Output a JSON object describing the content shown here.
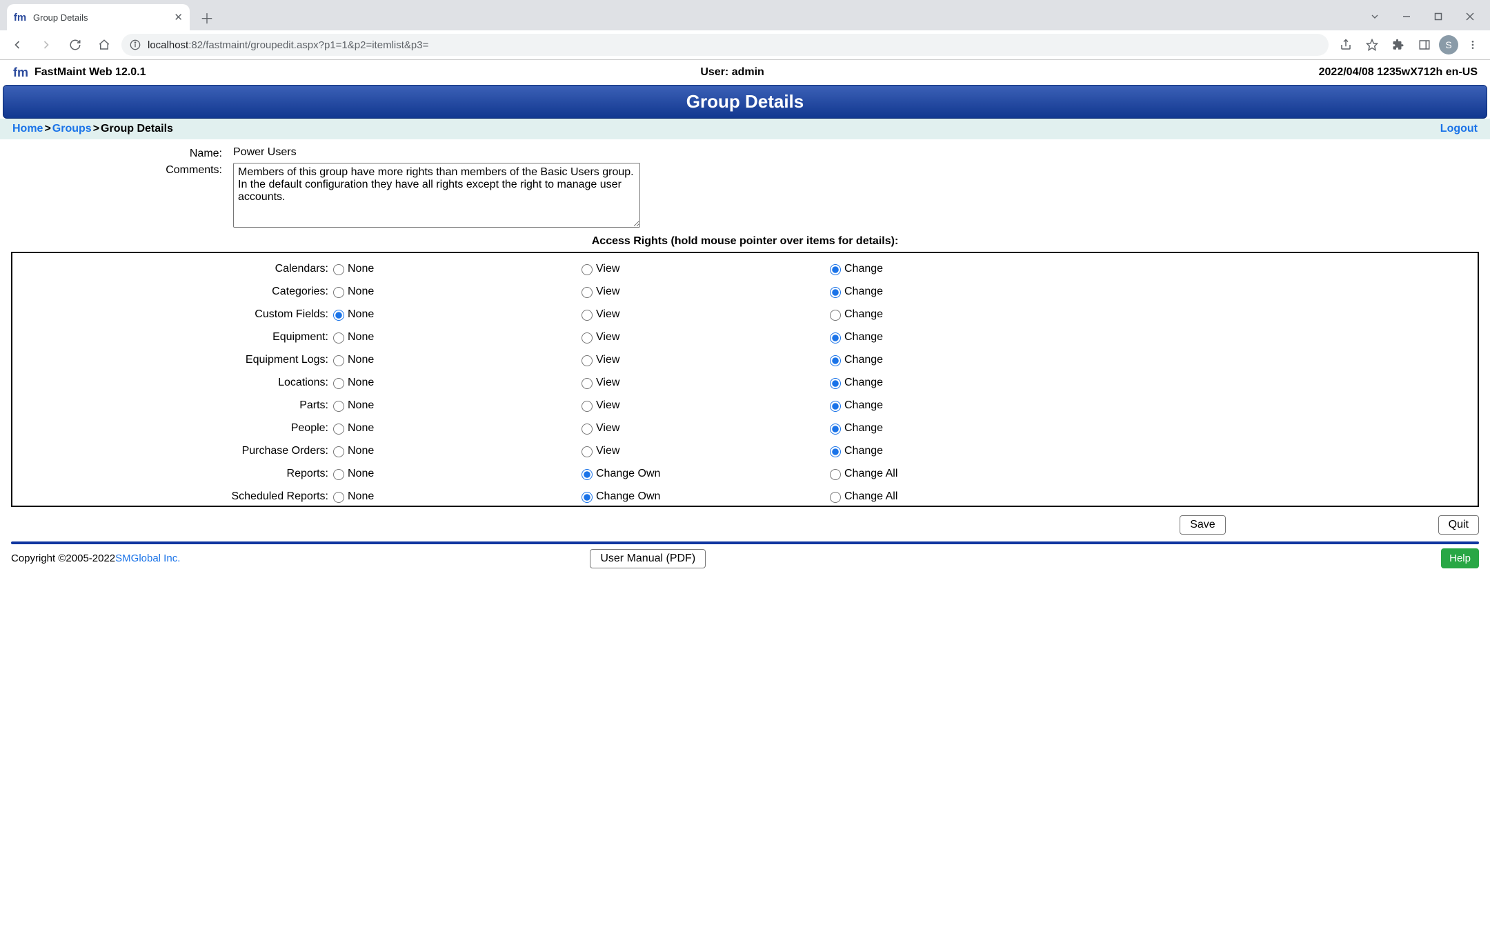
{
  "browser": {
    "tab_title": "Group Details",
    "url_host": "localhost",
    "url_port_path": ":82/fastmaint/groupedit.aspx?p1=1&p2=itemlist&p3=",
    "avatar_letter": "S"
  },
  "header": {
    "product": "FastMaint Web 12.0.1",
    "user": "User: admin",
    "stamp": "2022/04/08 1235wX712h en-US"
  },
  "banner": "Group Details",
  "crumbs": {
    "home": "Home",
    "groups": "Groups",
    "current": "Group Details",
    "logout": "Logout"
  },
  "form": {
    "name_label": "Name:",
    "name_value": "Power Users",
    "comments_label": "Comments:",
    "comments_value": "Members of this group have more rights than members of the Basic Users group. In the default configuration they have all rights except the right to manage user accounts."
  },
  "rights_header": "Access Rights (hold mouse pointer over items for details):",
  "rights": [
    {
      "label": "Calendars:",
      "o1": "None",
      "o2": "View",
      "o3": "Change",
      "sel": 2
    },
    {
      "label": "Categories:",
      "o1": "None",
      "o2": "View",
      "o3": "Change",
      "sel": 2
    },
    {
      "label": "Custom Fields:",
      "o1": "None",
      "o2": "View",
      "o3": "Change",
      "sel": 0
    },
    {
      "label": "Equipment:",
      "o1": "None",
      "o2": "View",
      "o3": "Change",
      "sel": 2
    },
    {
      "label": "Equipment Logs:",
      "o1": "None",
      "o2": "View",
      "o3": "Change",
      "sel": 2
    },
    {
      "label": "Locations:",
      "o1": "None",
      "o2": "View",
      "o3": "Change",
      "sel": 2
    },
    {
      "label": "Parts:",
      "o1": "None",
      "o2": "View",
      "o3": "Change",
      "sel": 2
    },
    {
      "label": "People:",
      "o1": "None",
      "o2": "View",
      "o3": "Change",
      "sel": 2
    },
    {
      "label": "Purchase Orders:",
      "o1": "None",
      "o2": "View",
      "o3": "Change",
      "sel": 2
    },
    {
      "label": "Reports:",
      "o1": "None",
      "o2": "Change Own",
      "o3": "Change All",
      "sel": 1
    },
    {
      "label": "Scheduled Reports:",
      "o1": "None",
      "o2": "Change Own",
      "o3": "Change All",
      "sel": 1
    }
  ],
  "buttons": {
    "save": "Save",
    "quit": "Quit"
  },
  "footer": {
    "copyright": "Copyright ©2005-2022 ",
    "company": "SMGlobal Inc.",
    "manual": "User Manual (PDF)",
    "help": "Help"
  }
}
